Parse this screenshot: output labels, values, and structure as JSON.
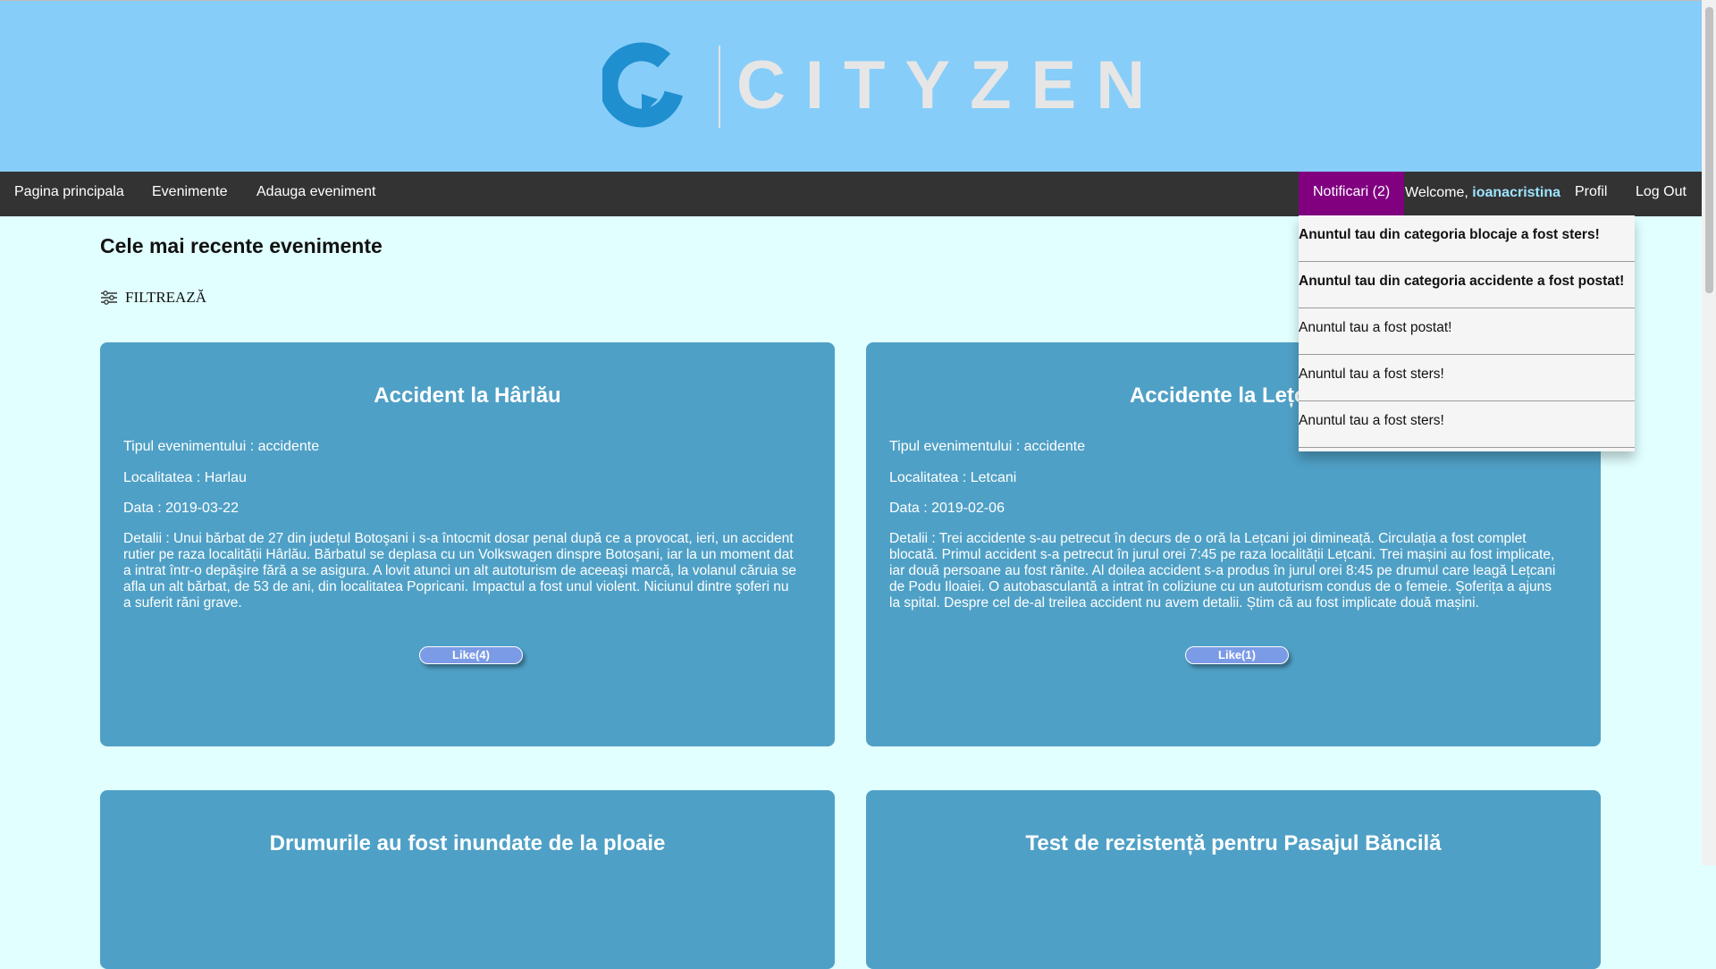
{
  "header": {
    "logo_text": "CITYZEN"
  },
  "nav": {
    "home": "Pagina principala",
    "events": "Evenimente",
    "add_event": "Adauga eveniment",
    "notifications": "Notificari (2)",
    "welcome_prefix": "Welcome, ",
    "username": "ioanacristina",
    "profile": "Profil",
    "logout": "Log Out"
  },
  "notifications": [
    {
      "text": "Anuntul tau din categoria blocaje a fost sters!",
      "unread": true
    },
    {
      "text": "Anuntul tau din categoria accidente a fost postat!",
      "unread": true
    },
    {
      "text": "Anuntul tau a fost postat!",
      "unread": false
    },
    {
      "text": "Anuntul tau a fost sters!",
      "unread": false
    },
    {
      "text": "Anuntul tau a fost sters!",
      "unread": false
    }
  ],
  "main": {
    "title": "Cele mai recente evenimente",
    "filter_label": "FILTREAZĂ"
  },
  "events": [
    {
      "title": "Accident la Hârlău",
      "type": "Tipul evenimentului : accidente",
      "locality": "Localitatea : Harlau",
      "date": "Data : 2019-03-22",
      "details": "Detalii : Unui bărbat de 27 din județul Botoşani i s-a întocmit dosar penal după ce a provocat, ieri, un accident rutier pe raza localității Hârlău. Bărbatul se deplasa cu un Volkswagen dinspre Botoşani, iar la un moment dat a intrat într-o depăşire fără a se asigura. A lovit atunci un alt autoturism de aceeaşi marcă, la volanul căruia se afla un alt bărbat, de 53 de ani, din localitatea Popricani. Impactul a fost unul violent. Niciunul dintre şoferi nu a suferit răni grave.",
      "like": "Like(4)"
    },
    {
      "title": "Accidente la Lețcani",
      "type": "Tipul evenimentului : accidente",
      "locality": "Localitatea : Letcani",
      "date": "Data : 2019-02-06",
      "details": "Detalii : Trei accidente s-au petrecut în decurs de o oră la Lețcani joi dimineață. Circulația a fost complet blocată. Primul accident s-a petrecut în jurul orei 7:45 pe raza localității Lețcani. Trei mașini au fost implicate, iar două persoane au fost rănite. Al doilea accident s-a produs în jurul orei 8:45 pe drumul care leagă Lețcani de Podu Iloaiei. O autobasculantă a intrat în coliziune cu un autoturism condus de o femeie. Șoferița a ajuns la spital. Despre cel de-al treilea accident nu avem detalii. Știm că au fost implicate două mașini.",
      "like": "Like(1)"
    },
    {
      "title": "Drumurile au fost inundate de la ploaie"
    },
    {
      "title": "Test de rezistență pentru Pasajul Băncilă"
    }
  ]
}
